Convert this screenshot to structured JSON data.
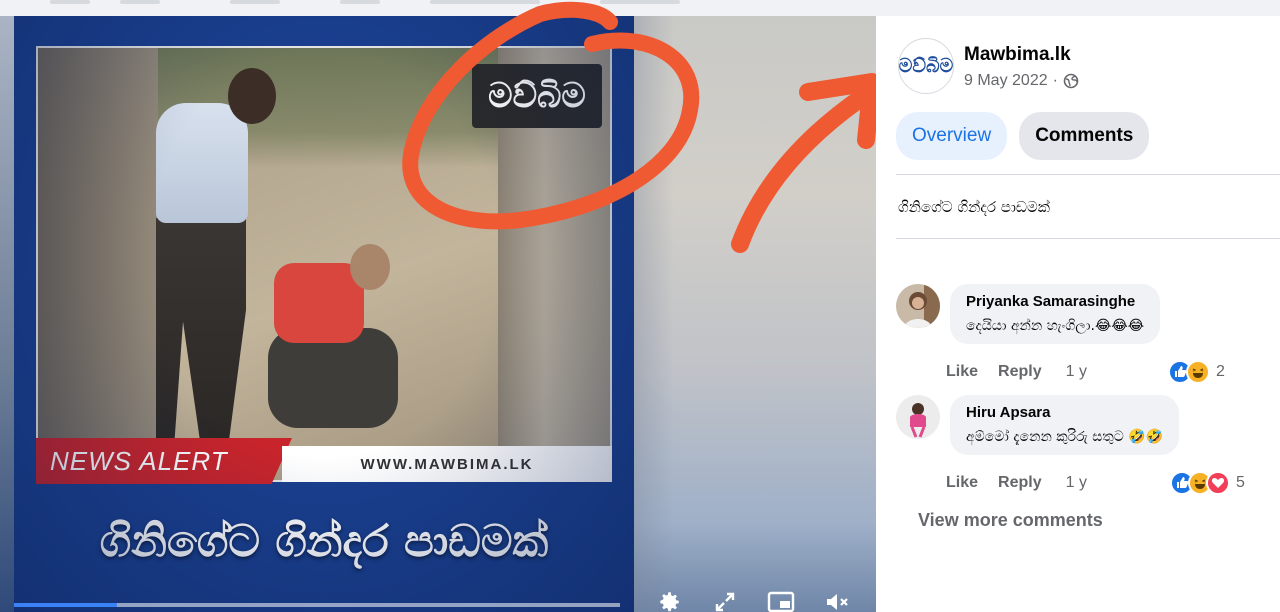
{
  "video": {
    "watermark": "මව්බිම",
    "news_alert": "NEWS ALERT",
    "url_banner": "WWW.MAWBIMA.LK",
    "caption": "ගිනිගේට ගින්දර පාඩමක්",
    "progress_fraction": 0.17,
    "controls": [
      "settings-icon",
      "fullscreen-icon",
      "picture-in-picture-icon",
      "mute-icon"
    ]
  },
  "post": {
    "page_avatar_text": "මව්බිම",
    "page_name": "Mawbima.lk",
    "date": "9 May 2022",
    "separator": "·",
    "privacy_icon": "globe-icon",
    "tabs": [
      {
        "label": "Overview",
        "active": true
      },
      {
        "label": "Comments",
        "active": false
      }
    ],
    "text": "ගිනිගේට ගින්දර පාඩමක්"
  },
  "comments": [
    {
      "name": "Priyanka Samarasinghe",
      "text": "දෙයියා අන්න හැංගිලා.😂😂😂",
      "like": "Like",
      "reply": "Reply",
      "time": "1 y",
      "reaction_icons": [
        "like-reaction-icon",
        "haha-reaction-icon"
      ],
      "reaction_count": "2"
    },
    {
      "name": "Hiru Apsara",
      "text": "අම්මෝ දැනෙන කුරිරු සතුට 🤣🤣",
      "like": "Like",
      "reply": "Reply",
      "time": "1 y",
      "reaction_icons": [
        "like-reaction-icon",
        "haha-reaction-icon",
        "love-reaction-icon"
      ],
      "reaction_count": "5"
    }
  ],
  "view_more": "View more comments",
  "colors": {
    "accent": "#1b74e4",
    "annotation": "#f05a33",
    "news_red": "#c8242b",
    "frame_blue": "#1a3f8e"
  }
}
